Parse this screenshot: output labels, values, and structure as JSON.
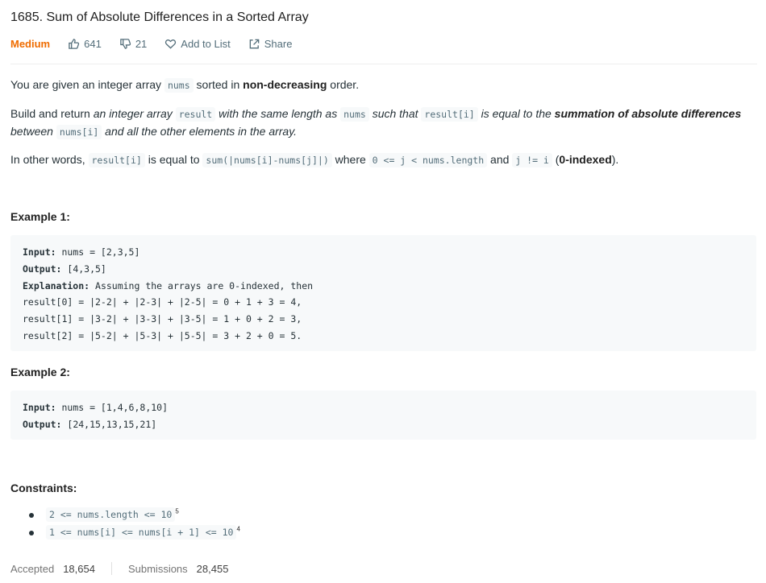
{
  "problem": {
    "title": "1685. Sum of Absolute Differences in a Sorted Array",
    "difficulty": "Medium",
    "likes": "641",
    "dislikes": "21",
    "add_to_list": "Add to List",
    "share": "Share"
  },
  "description": {
    "p1": {
      "t1": "You are given an integer array ",
      "c1": "nums",
      "t2": " sorted in ",
      "b1": "non-decreasing",
      "t3": " order."
    },
    "p2": {
      "t1": "Build and return ",
      "i1": "an integer array ",
      "c1": "result",
      "i2": " with the same length as ",
      "c2": "nums",
      "i3": " such that ",
      "c3": "result[i]",
      "i4": " is equal to the ",
      "b1": "summation of absolute differences",
      "i5": " between ",
      "c4": "nums[i]",
      "i6": " and all the other elements in the array."
    },
    "p3": {
      "t1": "In other words, ",
      "c1": "result[i]",
      "t2": " is equal to ",
      "c2": "sum(|nums[i]-nums[j]|)",
      "t3": " where ",
      "c3": "0 <= j < nums.length",
      "t4": " and ",
      "c4": "j != i",
      "t5": " (",
      "b1": "0-indexed",
      "t6": ")."
    }
  },
  "examples": [
    {
      "heading": "Example 1:",
      "input_label": "Input:",
      "input_value": " nums = [2,3,5]",
      "output_label": "Output:",
      "output_value": " [4,3,5]",
      "explanation_label": "Explanation:",
      "explanation_value": " Assuming the arrays are 0-indexed, then",
      "lines": [
        "result[0] = |2-2| + |2-3| + |2-5| = 0 + 1 + 3 = 4,",
        "result[1] = |3-2| + |3-3| + |3-5| = 1 + 0 + 2 = 3,",
        "result[2] = |5-2| + |5-3| + |5-5| = 3 + 2 + 0 = 5."
      ]
    },
    {
      "heading": "Example 2:",
      "input_label": "Input:",
      "input_value": " nums = [1,4,6,8,10]",
      "output_label": "Output:",
      "output_value": " [24,15,13,15,21]"
    }
  ],
  "constraints": {
    "heading": "Constraints:",
    "items": [
      {
        "code": "2 <= nums.length <= 10",
        "sup": "5"
      },
      {
        "code": "1 <= nums[i] <= nums[i + 1] <= 10",
        "sup": "4"
      }
    ]
  },
  "stats": {
    "accepted_label": "Accepted",
    "accepted_value": "18,654",
    "submissions_label": "Submissions",
    "submissions_value": "28,455"
  },
  "icons": [
    "thumbs-up-icon",
    "thumbs-down-icon",
    "heart-icon",
    "share-icon"
  ],
  "colors": {
    "difficulty_medium": "#ef6c00",
    "code_bg": "#f7f9fa",
    "meta_text": "#546e7a"
  }
}
